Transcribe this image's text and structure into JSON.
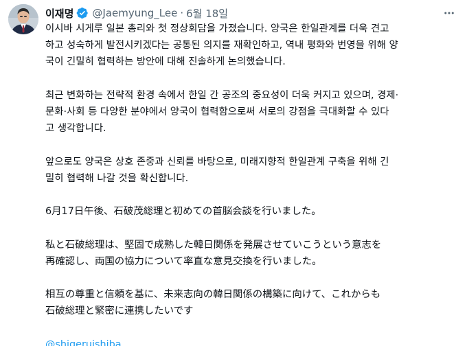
{
  "tweet": {
    "display_name": "이재명",
    "handle": "@Jaemyung_Lee",
    "separator": "·",
    "date": "6월 18일",
    "paragraphs": [
      "이시바 시게루 일본 총리와 첫 정상회담을 가졌습니다. 양국은 한일관계를 더욱 견고\n하고 성숙하게 발전시키겠다는 공통된 의지를 재확인하고, 역내 평화와 번영을 위해 양\n국이 긴밀히 협력하는 방안에 대해 진솔하게 논의했습니다.",
      "최근 변화하는 전략적 환경 속에서 한일 간 공조의 중요성이 더욱 커지고 있으며, 경제·\n문화·사회 등 다양한 분야에서 양국이 협력함으로써 서로의 강점을 극대화할 수 있다\n고 생각합니다.",
      "앞으로도 양국은 상호 존중과 신뢰를 바탕으로, 미래지향적 한일관계 구축을 위해 긴\n밀히 협력해 나갈 것을 확신합니다.",
      "6月17日午後、石破茂総理と初めての首脳会談を行いました。",
      "私と石破総理は、堅固で成熟した韓日関係を発展させていこうという意志を\n再確認し、両国の協力について率直な意見交換を行いました。",
      "相互の尊重と信頼を基に、未来志向の韓日関係の構築に向けて、これからも\n石破総理と緊密に連携したいです"
    ],
    "mention": "@shigeruishiba"
  },
  "icons": {
    "verified": "verified-badge-icon",
    "more": "more-options-icon",
    "avatar": "profile-photo"
  },
  "colors": {
    "text": "#0f1419",
    "secondary": "#536471",
    "link": "#1d9bf0",
    "background": "#ffffff"
  }
}
